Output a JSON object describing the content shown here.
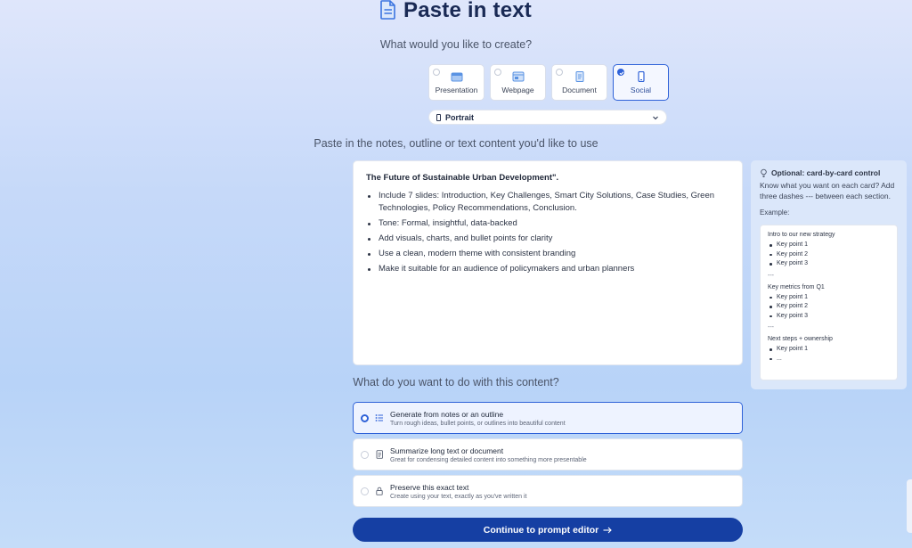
{
  "page": {
    "title": "Paste in text",
    "question_create": "What would you like to create?",
    "question_paste": "Paste in the notes, outline or text content you'd like to use",
    "question_action": "What do you want to do with this content?"
  },
  "types": [
    {
      "label": "Presentation",
      "icon": "presentation-icon",
      "selected": false
    },
    {
      "label": "Webpage",
      "icon": "webpage-icon",
      "selected": false
    },
    {
      "label": "Document",
      "icon": "document-icon",
      "selected": false
    },
    {
      "label": "Social",
      "icon": "phone-icon",
      "selected": true
    }
  ],
  "format_select": {
    "value": "Portrait"
  },
  "editor": {
    "title": "The Future of Sustainable Urban Development\".",
    "bullets": [
      "Include 7 slides: Introduction, Key Challenges, Smart City Solutions, Case Studies, Green Technologies, Policy Recommendations, Conclusion.",
      "Tone: Formal, insightful, data-backed",
      "Add visuals, charts, and bullet points for clarity",
      "Use a clean, modern theme with consistent branding",
      "Make it suitable for an audience of policymakers and urban planners"
    ]
  },
  "tips": {
    "heading": "Optional: card-by-card control",
    "description": "Know what you want on each card? Add three dashes --- between each section.",
    "example_label": "Example:",
    "sections": [
      {
        "title": "Intro to our new strategy",
        "items": [
          "Key point 1",
          "Key point 2",
          "Key point 3"
        ],
        "separator": "---"
      },
      {
        "title": "Key metrics from Q1",
        "items": [
          "Key point 1",
          "Key point 2",
          "Key point 3"
        ],
        "separator": "---"
      },
      {
        "title": "Next steps + ownership",
        "items": [
          "Key point 1",
          "..."
        ],
        "separator": ""
      }
    ]
  },
  "options": [
    {
      "title": "Generate from notes or an outline",
      "desc": "Turn rough ideas, bullet points, or outlines into beautiful content",
      "icon": "list-icon",
      "selected": true
    },
    {
      "title": "Summarize long text or document",
      "desc": "Great for condensing detailed content into something more presentable",
      "icon": "file-text-icon",
      "selected": false
    },
    {
      "title": "Preserve this exact text",
      "desc": "Create using your text, exactly as you've written it",
      "icon": "lock-icon",
      "selected": false
    }
  ],
  "cta": {
    "label": "Continue to prompt editor"
  },
  "colors": {
    "accent": "#2f62d8",
    "cta": "#153fa3",
    "title": "#1a2a55"
  }
}
